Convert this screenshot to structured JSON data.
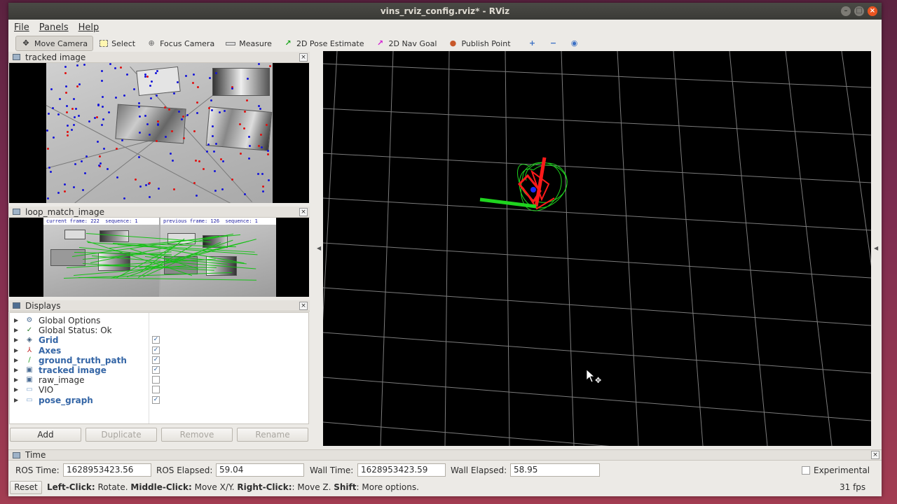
{
  "window": {
    "title": "vins_rviz_config.rviz* - RViz"
  },
  "menu": {
    "file": "File",
    "panels": "Panels",
    "help": "Help"
  },
  "toolbar": {
    "move_camera": "Move Camera",
    "select": "Select",
    "focus_camera": "Focus Camera",
    "measure": "Measure",
    "pose_estimate": "2D Pose Estimate",
    "nav_goal": "2D Nav Goal",
    "publish_point": "Publish Point"
  },
  "panels": {
    "tracked_image": {
      "title": "tracked image"
    },
    "loop_match_image": {
      "title": "loop_match_image",
      "current_label": "current frame: 222  sequence: 1",
      "previous_label": "previous frame: 126  sequence: 1"
    }
  },
  "displays": {
    "title": "Displays",
    "items": [
      {
        "label": "Global Options",
        "icon": "gear-icon",
        "checkbox": null,
        "bold": false
      },
      {
        "label": "Global Status: Ok",
        "icon": "check-icon",
        "checkbox": null,
        "bold": false
      },
      {
        "label": "Grid",
        "icon": "grid-icon",
        "checkbox": true,
        "bold": true
      },
      {
        "label": "Axes",
        "icon": "axes-icon",
        "checkbox": true,
        "bold": true
      },
      {
        "label": "ground_truth_path",
        "icon": "path-icon",
        "checkbox": true,
        "bold": true
      },
      {
        "label": "tracked image",
        "icon": "image-icon",
        "checkbox": true,
        "bold": true
      },
      {
        "label": "raw_image",
        "icon": "image-icon",
        "checkbox": false,
        "bold": false
      },
      {
        "label": "VIO",
        "icon": "folder-icon",
        "checkbox": false,
        "bold": false
      },
      {
        "label": "pose_graph",
        "icon": "folder-icon",
        "checkbox": true,
        "bold": true
      }
    ],
    "buttons": {
      "add": "Add",
      "duplicate": "Duplicate",
      "remove": "Remove",
      "rename": "Rename"
    }
  },
  "time": {
    "title": "Time",
    "ros_time_label": "ROS Time:",
    "ros_time": "1628953423.56",
    "ros_elapsed_label": "ROS Elapsed:",
    "ros_elapsed": "59.04",
    "wall_time_label": "Wall Time:",
    "wall_time": "1628953423.59",
    "wall_elapsed_label": "Wall Elapsed:",
    "wall_elapsed": "58.95",
    "experimental_label": "Experimental"
  },
  "status": {
    "reset": "Reset",
    "left_click": "Left-Click:",
    "left_click_desc": " Rotate. ",
    "middle_click": "Middle-Click:",
    "middle_click_desc": " Move X/Y. ",
    "right_click": "Right-Click:",
    "right_click_desc": ": Move Z. ",
    "shift": "Shift",
    "shift_desc": ": More options.",
    "fps": "31 fps"
  },
  "colors": {
    "accent_orange": "#e95420",
    "track_green": "#18d418",
    "pose_red": "#ff1a1a",
    "label_blue": "#3566a6"
  }
}
